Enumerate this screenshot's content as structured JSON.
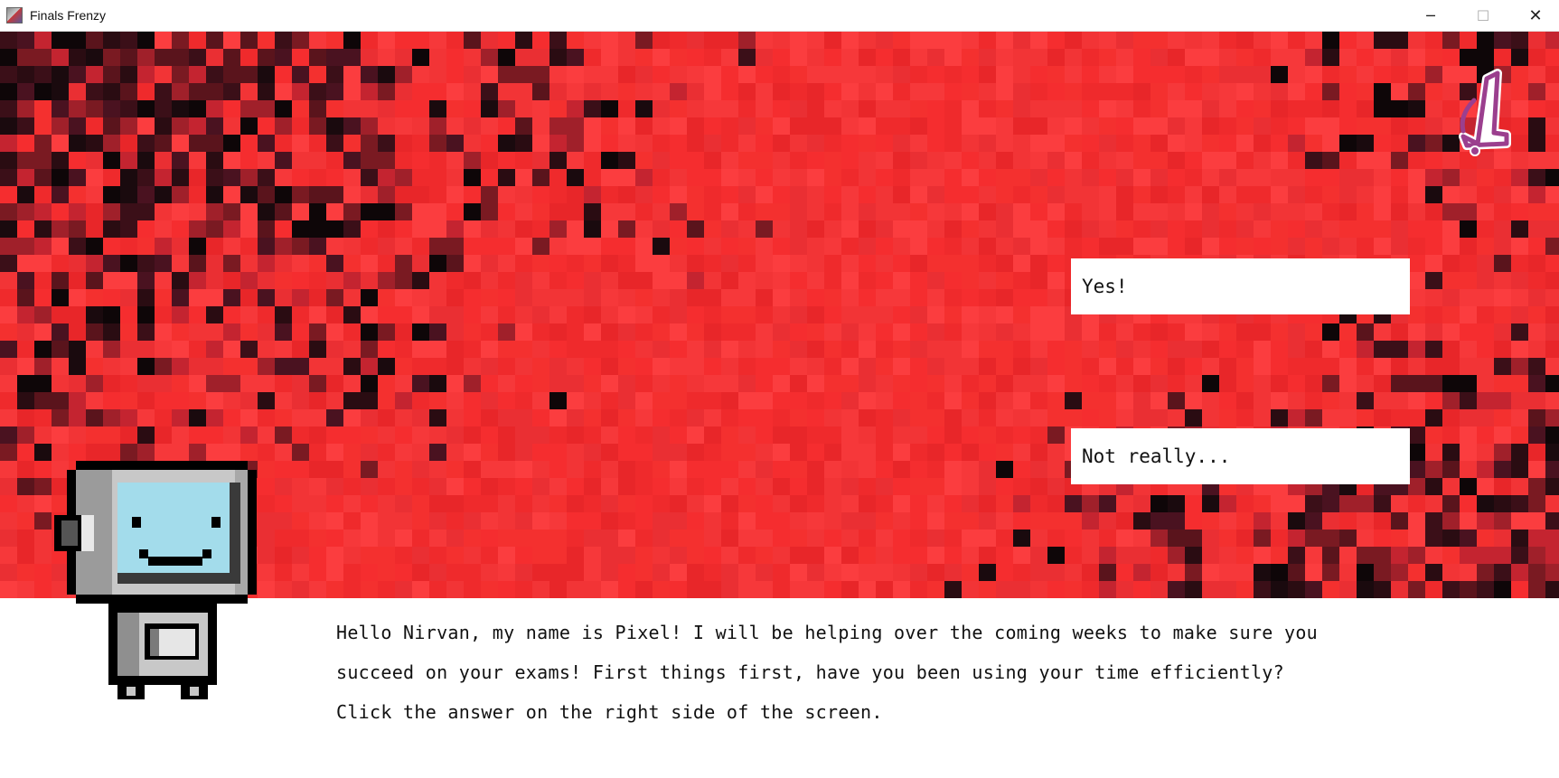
{
  "window": {
    "title": "Finals Frenzy",
    "minimize_glyph": "─",
    "maximize_glyph": "☐",
    "close_glyph": "✕"
  },
  "game": {
    "level_badge_icon": "number-one-bell-icon",
    "answers": [
      {
        "label": "Yes!"
      },
      {
        "label": "Not really..."
      }
    ],
    "dialogue": {
      "lines": [
        "Hello Nirvan, my name is Pixel! I will be helping over the coming weeks to make sure you",
        "succeed on your exams! First things first, have you been using your time efficiently?",
        "Click the answer on the right side of the screen."
      ]
    },
    "character_icon": "pixel-robot-icon"
  },
  "colors": {
    "background_red": "#f52d2f",
    "dark_pixel": "#1a0a0e",
    "badge_purple": "#9b3f8e",
    "robot_screen": "#a3dceb"
  }
}
